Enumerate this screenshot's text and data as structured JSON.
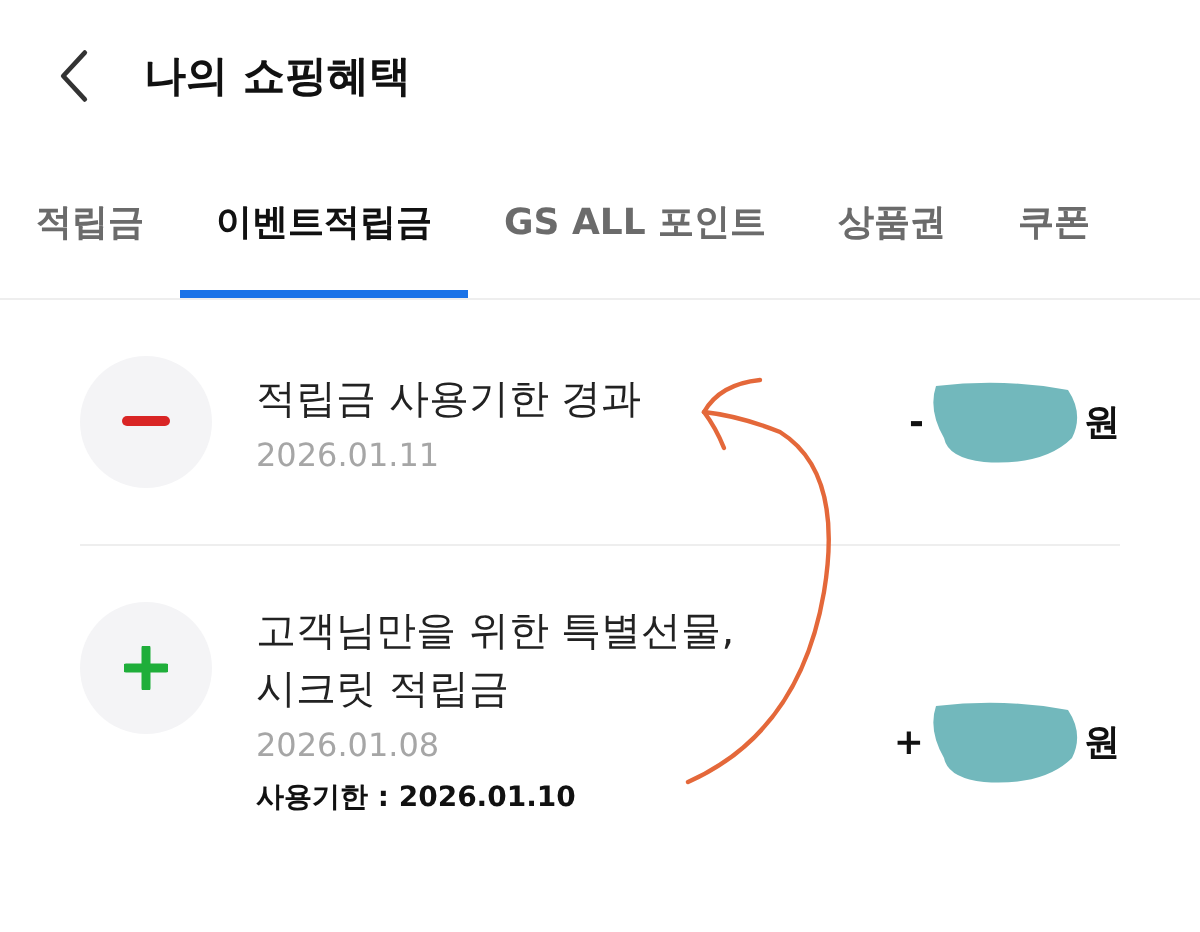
{
  "header": {
    "title": "나의 쇼핑혜택"
  },
  "tabs": [
    {
      "label": "적립금",
      "selected": false
    },
    {
      "label": "이벤트적립금",
      "selected": true
    },
    {
      "label": "GS ALL 포인트",
      "selected": false
    },
    {
      "label": "상품권",
      "selected": false
    },
    {
      "label": "쿠폰",
      "selected": false
    }
  ],
  "entries": [
    {
      "kind": "minus",
      "title": "적립금 사용기한 경과",
      "date": "2026.01.11",
      "amount_sign": "-",
      "amount_unit": "원"
    },
    {
      "kind": "plus",
      "title": "고객님만을 위한 특별선물,\n시크릿 적립금",
      "date": "2026.01.08",
      "expiry": "사용기한 : 2026.01.10",
      "amount_sign": "+",
      "amount_unit": "원"
    }
  ]
}
